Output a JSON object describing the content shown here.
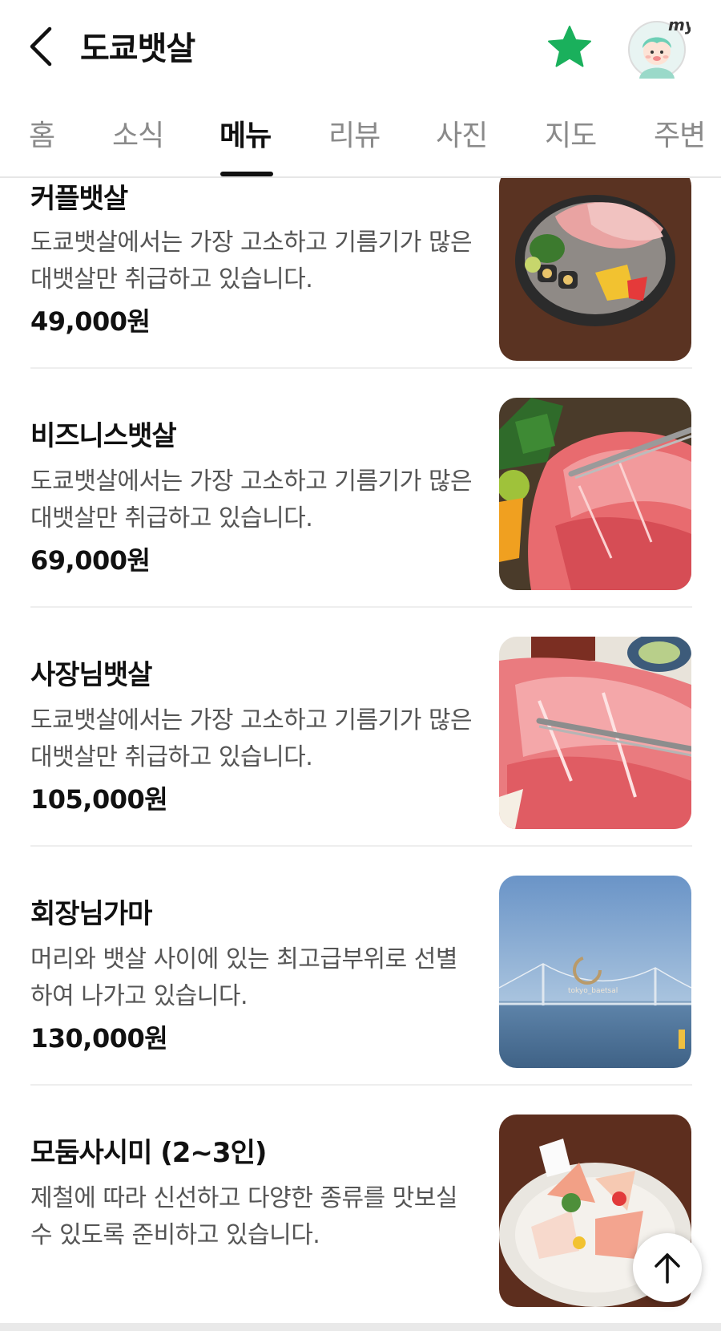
{
  "header": {
    "title": "도쿄뱃살",
    "back_icon": "chevron-left-icon",
    "favorite_icon": "star-icon",
    "favorite_color": "#1ab05c",
    "avatar_badge": "my"
  },
  "tabs": [
    {
      "label": "홈",
      "active": false
    },
    {
      "label": "소식",
      "active": false
    },
    {
      "label": "메뉴",
      "active": true
    },
    {
      "label": "리뷰",
      "active": false
    },
    {
      "label": "사진",
      "active": false
    },
    {
      "label": "지도",
      "active": false
    },
    {
      "label": "주변",
      "active": false
    }
  ],
  "menu": {
    "items": [
      {
        "name": "커플뱃살",
        "desc": "도쿄뱃살에서는 가장 고소하고 기름기가 많은 대뱃살만 취급하고 있습니다.",
        "price": "49,000원"
      },
      {
        "name": "비즈니스뱃살",
        "desc": "도쿄뱃살에서는 가장 고소하고 기름기가 많은 대뱃살만 취급하고 있습니다.",
        "price": "69,000원"
      },
      {
        "name": "사장님뱃살",
        "desc": "도쿄뱃살에서는 가장 고소하고 기름기가 많은 대뱃살만 취급하고 있습니다.",
        "price": "105,000원"
      },
      {
        "name": "회장님가마",
        "desc": "머리와 뱃살 사이에 있는 최고급부위로 선별하여 나가고 있습니다.",
        "price": "130,000원",
        "image_watermark": "tokyo_baetsal"
      },
      {
        "name": "모둠사시미 (2~3인)",
        "desc": "제철에 따라 신선하고 다양한 종류를 맛보실 수 있도록 준비하고 있습니다.",
        "price": ""
      }
    ]
  },
  "scroll_top_icon": "arrow-up-icon"
}
